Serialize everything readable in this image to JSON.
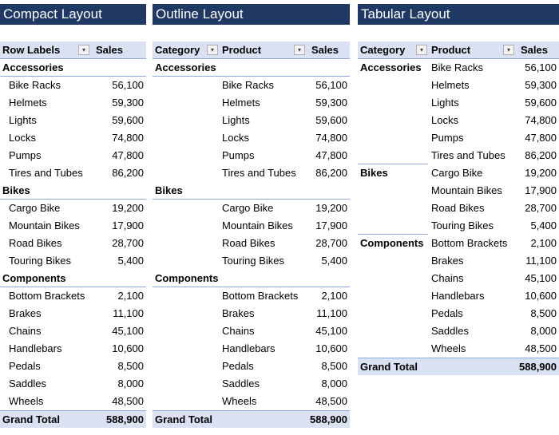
{
  "titles": {
    "compact": "Compact Layout",
    "outline": "Outline Layout",
    "tabular": "Tabular Layout"
  },
  "headers": {
    "row_labels": "Row Labels",
    "category": "Category",
    "product": "Product",
    "sales": "Sales"
  },
  "icons": {
    "filter": "▾",
    "dropdown": "▾"
  },
  "categories": [
    {
      "name": "Accessories",
      "items": [
        {
          "product": "Bike Racks",
          "sales": "56,100"
        },
        {
          "product": "Helmets",
          "sales": "59,300"
        },
        {
          "product": "Lights",
          "sales": "59,600"
        },
        {
          "product": "Locks",
          "sales": "74,800"
        },
        {
          "product": "Pumps",
          "sales": "47,800"
        },
        {
          "product": "Tires and Tubes",
          "sales": "86,200"
        }
      ]
    },
    {
      "name": "Bikes",
      "items": [
        {
          "product": "Cargo Bike",
          "sales": "19,200"
        },
        {
          "product": "Mountain Bikes",
          "sales": "17,900"
        },
        {
          "product": "Road Bikes",
          "sales": "28,700"
        },
        {
          "product": "Touring Bikes",
          "sales": "5,400"
        }
      ]
    },
    {
      "name": "Components",
      "items": [
        {
          "product": "Bottom Brackets",
          "sales": "2,100"
        },
        {
          "product": "Brakes",
          "sales": "11,100"
        },
        {
          "product": "Chains",
          "sales": "45,100"
        },
        {
          "product": "Handlebars",
          "sales": "10,600"
        },
        {
          "product": "Pedals",
          "sales": "8,500"
        },
        {
          "product": "Saddles",
          "sales": "8,000"
        },
        {
          "product": "Wheels",
          "sales": "48,500"
        }
      ]
    }
  ],
  "grand_total": {
    "label": "Grand Total",
    "sales": "588,900"
  }
}
